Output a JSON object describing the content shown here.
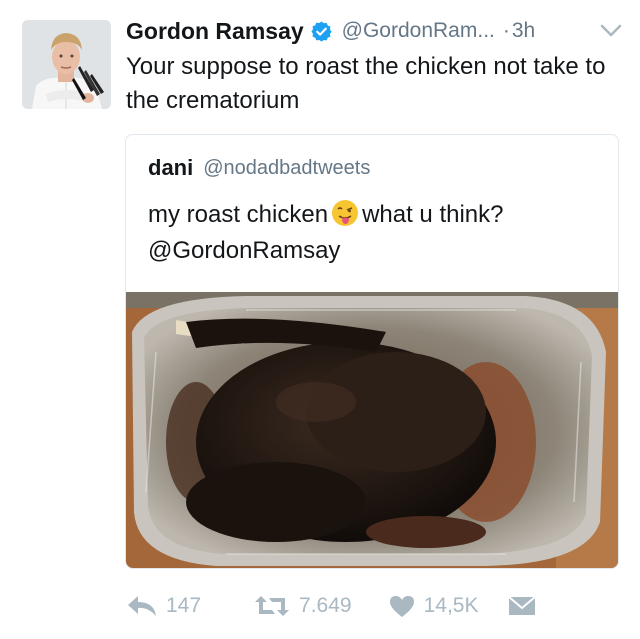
{
  "tweet": {
    "author_name": "Gordon Ramsay",
    "author_handle": "@GordonRam...",
    "separator": "·",
    "time": "3h",
    "text": "Your suppose to roast the chicken not take to the crematorium",
    "verified_icon": "verified-badge-icon",
    "menu_icon": "chevron-down-icon"
  },
  "quoted_tweet": {
    "author_name": "dani",
    "author_handle": "@nodadbadtweets",
    "text_before_emoji": "my roast chicken",
    "emoji": "face-with-tongue-emoji",
    "text_after_emoji": "what u think? @GordonRamsay",
    "image": "burnt-roast-chicken-photo"
  },
  "actions": {
    "reply_icon": "reply-icon",
    "reply_count": "147",
    "retweet_icon": "retweet-icon",
    "retweet_count": "7.649",
    "like_icon": "heart-icon",
    "like_count": "14,5K",
    "dm_icon": "envelope-icon"
  },
  "colors": {
    "text": "#14171a",
    "secondary": "#657786",
    "verified": "#1da1f2",
    "action_gray": "#aab8c2",
    "border": "#e1e8ed"
  }
}
